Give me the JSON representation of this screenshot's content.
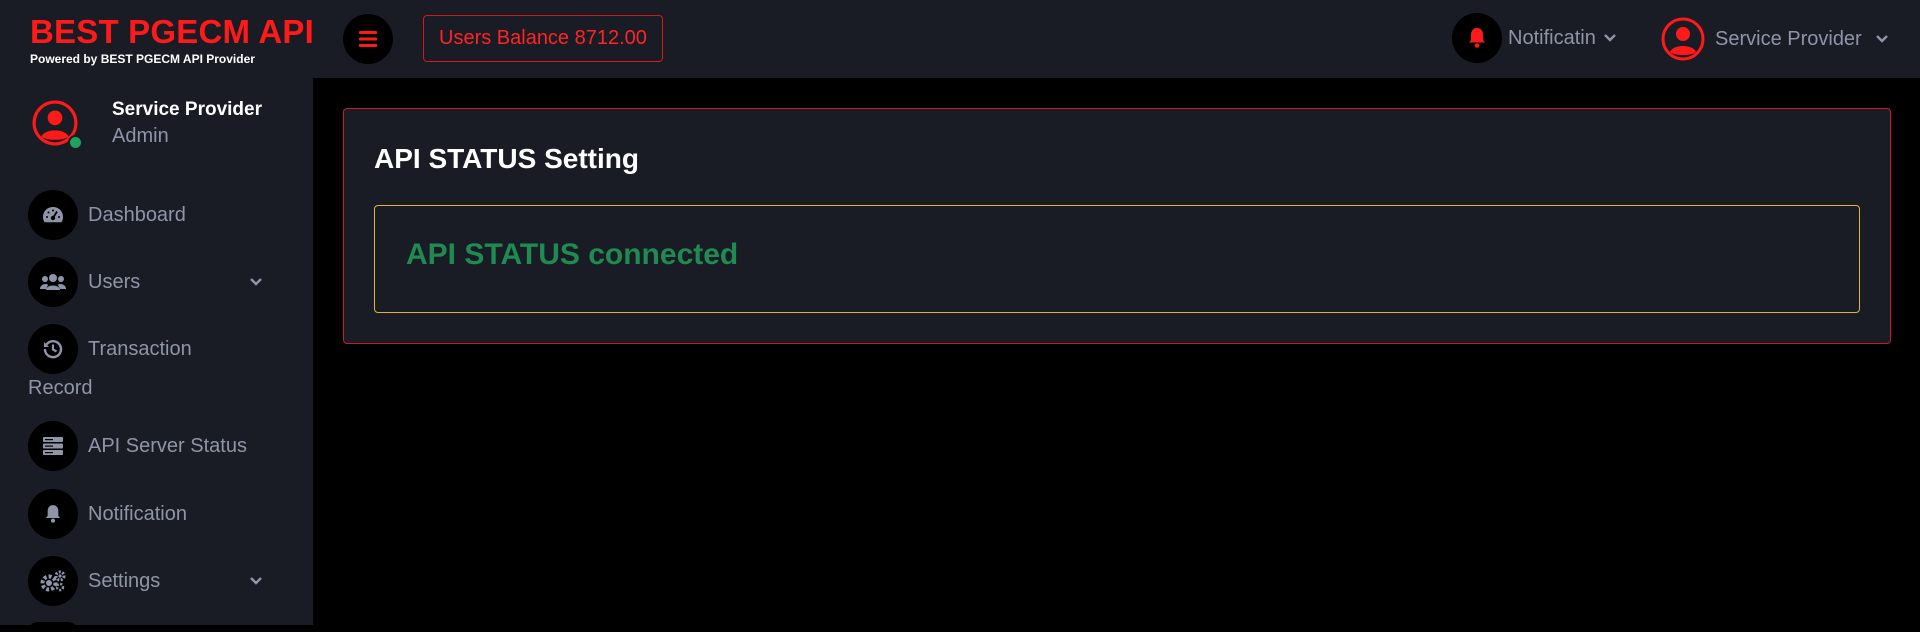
{
  "brand": {
    "title": "BEST PGECM API",
    "subtitle": "Powered by BEST PGECM API Provider"
  },
  "topbar": {
    "balance_label": "Users Balance 8712.00",
    "notification_label": "Notificatin",
    "profile_label": "Service Provider"
  },
  "sidebar": {
    "user_name": "Service Provider",
    "user_role": "Admin",
    "items": [
      {
        "label": "Dashboard",
        "icon": "dashboard-icon"
      },
      {
        "label": "Users",
        "icon": "users-icon"
      },
      {
        "label_line1": "Transaction",
        "label_line2": "Record",
        "icon": "history-icon"
      },
      {
        "label": "API Server Status",
        "icon": "server-icon"
      },
      {
        "label": "Notification",
        "icon": "bell-icon"
      },
      {
        "label": "Settings",
        "icon": "gears-icon"
      }
    ]
  },
  "main": {
    "card_title": "API STATUS Setting",
    "status_text": "API STATUS connected"
  },
  "colors": {
    "accent_red": "#ff1a1a",
    "status_green": "#1f8a52",
    "status_border": "#e0b23b",
    "panel_bg": "#191c24"
  }
}
